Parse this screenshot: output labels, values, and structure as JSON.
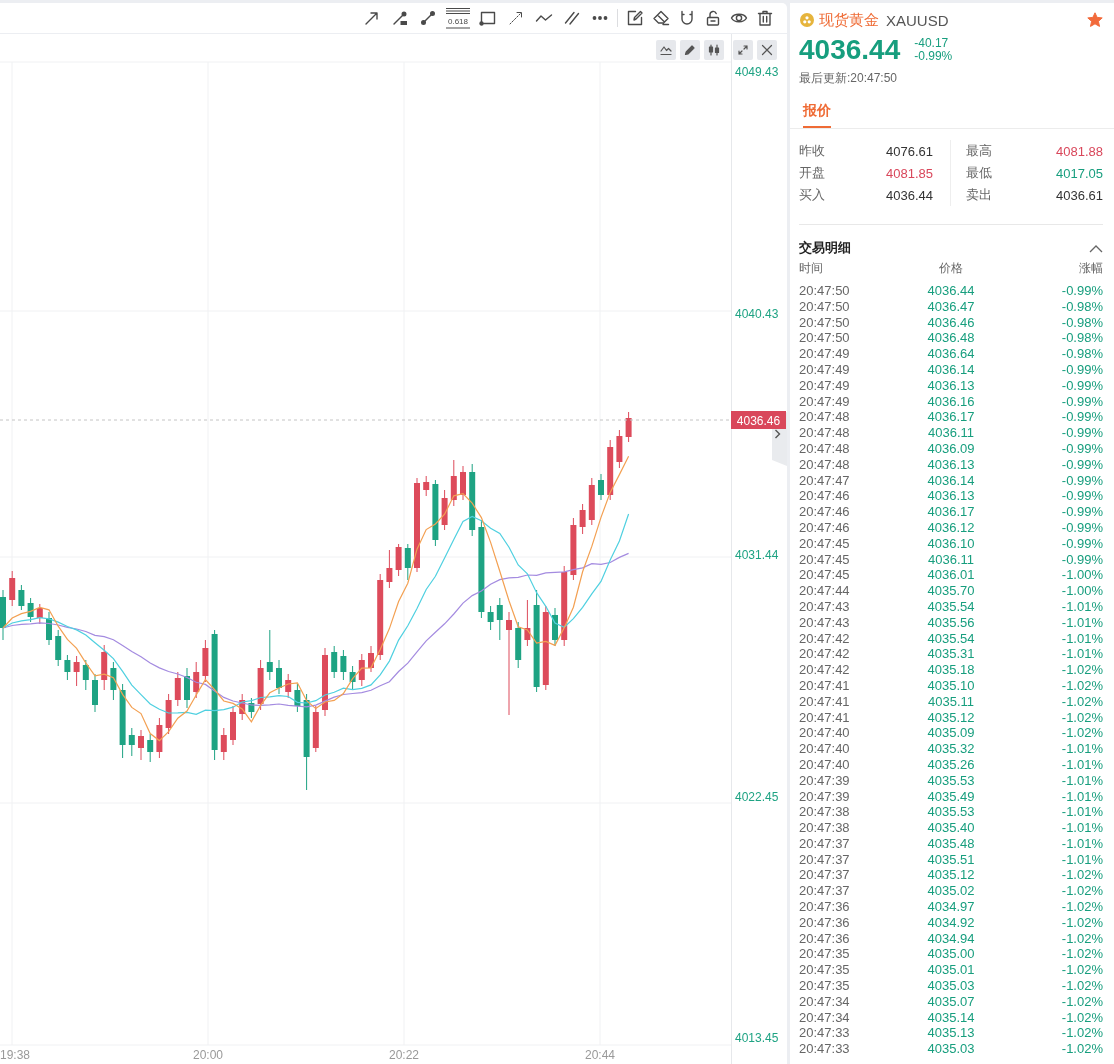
{
  "toolbar": {
    "draw_tools": [
      {
        "kind": "arrow"
      },
      {
        "kind": "ray"
      },
      {
        "kind": "segment"
      },
      {
        "kind": "fibonacci",
        "label": "0.618"
      },
      {
        "kind": "rectangle"
      },
      {
        "kind": "extended_line"
      },
      {
        "kind": "polyline"
      },
      {
        "kind": "parallel"
      },
      {
        "kind": "more"
      }
    ],
    "edit_tools": [
      {
        "kind": "note"
      },
      {
        "kind": "eraser"
      },
      {
        "kind": "magnet"
      },
      {
        "kind": "lock"
      },
      {
        "kind": "visibility"
      },
      {
        "kind": "delete"
      }
    ]
  },
  "chart": {
    "buttons": [
      {
        "kind": "indicator"
      },
      {
        "kind": "draw"
      },
      {
        "kind": "candles"
      },
      {
        "kind": "fullscreen"
      },
      {
        "kind": "close"
      }
    ],
    "price_axis": [
      "4049.43",
      "4040.43",
      "4031.44",
      "4022.45",
      "4013.45"
    ],
    "time_axis": [
      "19:38",
      "20:00",
      "20:22",
      "20:44"
    ],
    "last_price": "4036.46"
  },
  "quote": {
    "name": "现货黄金",
    "symbol": "XAUUSD",
    "starred": true,
    "price": "4036.44",
    "change": "-40.17",
    "change_pct": "-0.99%",
    "updated": "最后更新:20:47:50",
    "tabs": [
      {
        "label": "报价",
        "selected": true
      }
    ],
    "stats": [
      {
        "label": "昨收",
        "value": "4076.61",
        "color": "#333333"
      },
      {
        "label": "最高",
        "value": "4081.88",
        "color": "#d9475b"
      },
      {
        "label": "开盘",
        "value": "4081.85",
        "color": "#d9475b"
      },
      {
        "label": "最低",
        "value": "4017.05",
        "color": "#179e7e"
      },
      {
        "label": "买入",
        "value": "4036.44",
        "color": "#333333"
      },
      {
        "label": "卖出",
        "value": "4036.61",
        "color": "#333333"
      }
    ]
  },
  "trades": {
    "title": "交易明细",
    "expanded": true,
    "columns": [
      "时间",
      "价格",
      "涨幅"
    ],
    "rows": [
      {
        "time": "20:47:50",
        "price": "4036.44",
        "change": "-0.99%"
      },
      {
        "time": "20:47:50",
        "price": "4036.47",
        "change": "-0.98%"
      },
      {
        "time": "20:47:50",
        "price": "4036.46",
        "change": "-0.98%"
      },
      {
        "time": "20:47:50",
        "price": "4036.48",
        "change": "-0.98%"
      },
      {
        "time": "20:47:49",
        "price": "4036.64",
        "change": "-0.98%"
      },
      {
        "time": "20:47:49",
        "price": "4036.14",
        "change": "-0.99%"
      },
      {
        "time": "20:47:49",
        "price": "4036.13",
        "change": "-0.99%"
      },
      {
        "time": "20:47:49",
        "price": "4036.16",
        "change": "-0.99%"
      },
      {
        "time": "20:47:48",
        "price": "4036.17",
        "change": "-0.99%"
      },
      {
        "time": "20:47:48",
        "price": "4036.11",
        "change": "-0.99%"
      },
      {
        "time": "20:47:48",
        "price": "4036.09",
        "change": "-0.99%"
      },
      {
        "time": "20:47:48",
        "price": "4036.13",
        "change": "-0.99%"
      },
      {
        "time": "20:47:47",
        "price": "4036.14",
        "change": "-0.99%"
      },
      {
        "time": "20:47:46",
        "price": "4036.13",
        "change": "-0.99%"
      },
      {
        "time": "20:47:46",
        "price": "4036.17",
        "change": "-0.99%"
      },
      {
        "time": "20:47:46",
        "price": "4036.12",
        "change": "-0.99%"
      },
      {
        "time": "20:47:45",
        "price": "4036.10",
        "change": "-0.99%"
      },
      {
        "time": "20:47:45",
        "price": "4036.11",
        "change": "-0.99%"
      },
      {
        "time": "20:47:45",
        "price": "4036.01",
        "change": "-1.00%"
      },
      {
        "time": "20:47:44",
        "price": "4035.70",
        "change": "-1.00%"
      },
      {
        "time": "20:47:43",
        "price": "4035.54",
        "change": "-1.01%"
      },
      {
        "time": "20:47:43",
        "price": "4035.56",
        "change": "-1.01%"
      },
      {
        "time": "20:47:42",
        "price": "4035.54",
        "change": "-1.01%"
      },
      {
        "time": "20:47:42",
        "price": "4035.31",
        "change": "-1.01%"
      },
      {
        "time": "20:47:42",
        "price": "4035.18",
        "change": "-1.02%"
      },
      {
        "time": "20:47:41",
        "price": "4035.10",
        "change": "-1.02%"
      },
      {
        "time": "20:47:41",
        "price": "4035.11",
        "change": "-1.02%"
      },
      {
        "time": "20:47:41",
        "price": "4035.12",
        "change": "-1.02%"
      },
      {
        "time": "20:47:40",
        "price": "4035.09",
        "change": "-1.02%"
      },
      {
        "time": "20:47:40",
        "price": "4035.32",
        "change": "-1.01%"
      },
      {
        "time": "20:47:40",
        "price": "4035.26",
        "change": "-1.01%"
      },
      {
        "time": "20:47:39",
        "price": "4035.53",
        "change": "-1.01%"
      },
      {
        "time": "20:47:39",
        "price": "4035.49",
        "change": "-1.01%"
      },
      {
        "time": "20:47:38",
        "price": "4035.53",
        "change": "-1.01%"
      },
      {
        "time": "20:47:38",
        "price": "4035.40",
        "change": "-1.01%"
      },
      {
        "time": "20:47:37",
        "price": "4035.48",
        "change": "-1.01%"
      },
      {
        "time": "20:47:37",
        "price": "4035.51",
        "change": "-1.01%"
      },
      {
        "time": "20:47:37",
        "price": "4035.12",
        "change": "-1.02%"
      },
      {
        "time": "20:47:37",
        "price": "4035.02",
        "change": "-1.02%"
      },
      {
        "time": "20:47:36",
        "price": "4034.97",
        "change": "-1.02%"
      },
      {
        "time": "20:47:36",
        "price": "4034.92",
        "change": "-1.02%"
      },
      {
        "time": "20:47:36",
        "price": "4034.94",
        "change": "-1.02%"
      },
      {
        "time": "20:47:35",
        "price": "4035.00",
        "change": "-1.02%"
      },
      {
        "time": "20:47:35",
        "price": "4035.01",
        "change": "-1.02%"
      },
      {
        "time": "20:47:35",
        "price": "4035.03",
        "change": "-1.02%"
      },
      {
        "time": "20:47:34",
        "price": "4035.07",
        "change": "-1.02%"
      },
      {
        "time": "20:47:34",
        "price": "4035.14",
        "change": "-1.02%"
      },
      {
        "time": "20:47:33",
        "price": "4035.13",
        "change": "-1.02%"
      },
      {
        "time": "20:47:33",
        "price": "4035.03",
        "change": "-1.02%"
      }
    ]
  }
}
